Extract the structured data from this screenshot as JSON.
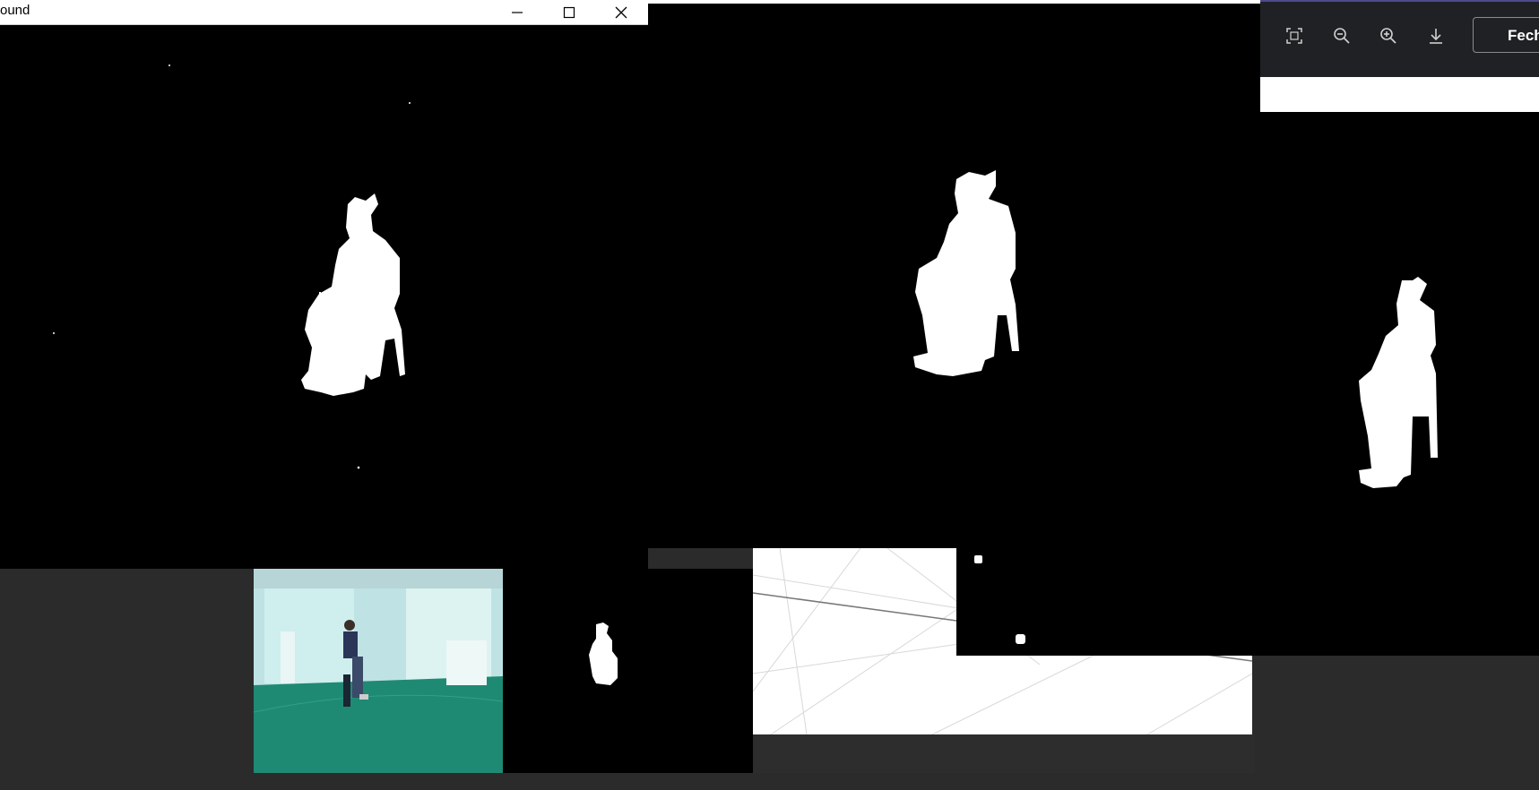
{
  "left_window": {
    "title": "ound",
    "buttons": {
      "minimize": "minimize",
      "maximize": "maximize",
      "close": "close"
    }
  },
  "viewer": {
    "toolbar_icons": [
      "fit-screen-icon",
      "zoom-out-icon",
      "zoom-in-icon",
      "download-icon"
    ],
    "close_label": "Fecha",
    "accent_color": "#4c4b8f"
  },
  "colors": {
    "mask_background": "#000000",
    "mask_foreground": "#ffffff",
    "desktop": "#2b2b2b",
    "floor": "#1f8a74"
  }
}
